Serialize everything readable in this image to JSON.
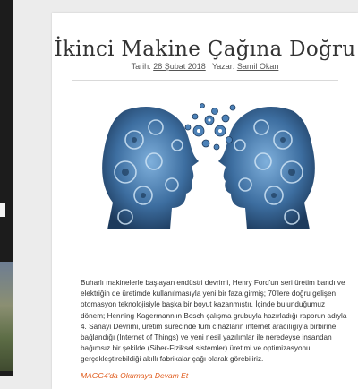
{
  "article": {
    "title": "İkinci Makine Çağına Doğru",
    "meta": {
      "date_label": "Tarih:",
      "date": "28 Şubat 2018",
      "separator": "|",
      "author_label": "Yazar:",
      "author": "Samil Okan"
    },
    "hero_image": "two-gear-heads-facing-image",
    "body": "Buharlı makinelerle başlayan endüstri devrimi, Henry Ford'un seri üretim bandı ve elektriğin de üretimde kullanılmasıyla yeni bir faza girmiş; 70'lere doğru gelişen otomasyon teknolojisiyle başka bir boyut kazanmıştır. İçinde bulunduğumuz dönem; Henning Kagermann'ın Bosch çalışma grubuyla hazırladığı raporun adıyla 4. Sanayi Devrimi, üretim sürecinde tüm cihazların internet aracılığıyla birbirine bağlandığı (Internet of Things) ve yeni nesil yazılımlar ile neredeyse insandan bağımsız bir şekilde (Siber-Fiziksel sistemler) üretimi ve optimizasyonu gerçekleştirebildiği akıllı fabrikalar çağı olarak görebiliriz.",
    "read_more": "MAGG4'da Okumaya Devam Et"
  },
  "colors": {
    "link_accent": "#e05a1a",
    "gear_blue": "#3d6ea0"
  }
}
